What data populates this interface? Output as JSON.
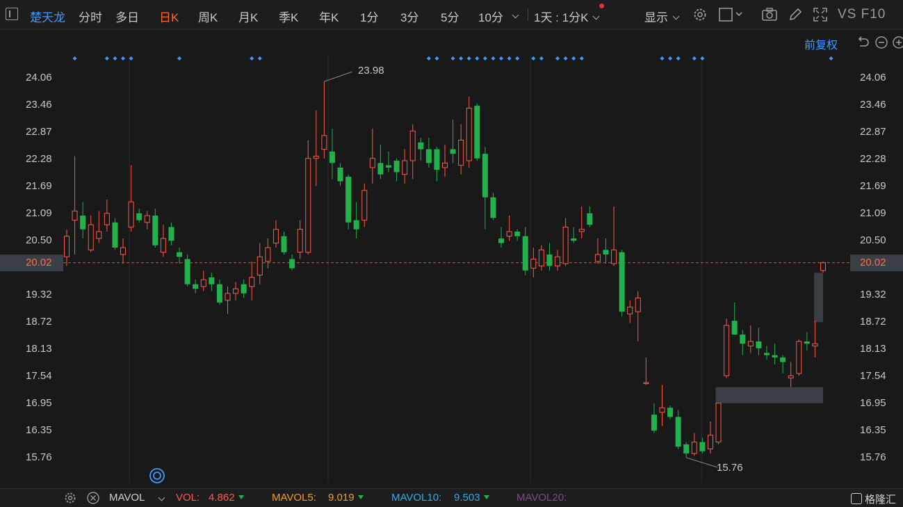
{
  "toolbar": {
    "stock_name": "楚天龙",
    "periods": [
      "分时",
      "多日",
      "日K",
      "周K",
      "月K",
      "季K",
      "年K",
      "1分",
      "3分",
      "5分",
      "10分"
    ],
    "active_period": "日K",
    "multi_period": "1天 : 1分K",
    "display_label": "显示",
    "vs_f10": "VS F10"
  },
  "chart_header": {
    "adjust_label": "前复权"
  },
  "price_axis": {
    "ticks": [
      "24.06",
      "23.46",
      "22.87",
      "22.28",
      "21.69",
      "21.09",
      "20.50",
      "20.02",
      "19.32",
      "18.72",
      "18.13",
      "17.54",
      "16.95",
      "16.35",
      "15.76"
    ],
    "current_price": "20.02"
  },
  "annotations": {
    "high_label": "23.98",
    "low_label": "15.76"
  },
  "indicator_bar": {
    "name": "MAVOL",
    "vol_label": "VOL:",
    "vol_value": "4.862",
    "mavol5_label": "MAVOL5:",
    "mavol5_value": "9.019",
    "mavol10_label": "MAVOL10:",
    "mavol10_value": "9.503",
    "mavol20_label": "MAVOL20:",
    "brand": "格隆汇"
  },
  "colors": {
    "up": "#ff5a4a",
    "down": "#23b14d",
    "accent_blue": "#3e9bff",
    "active_orange": "#ff6a2b",
    "background": "#191919"
  },
  "chart_data": {
    "type": "candlestick",
    "y_range": [
      15.5,
      24.5
    ],
    "current_price": 20.02,
    "marked_high": 23.98,
    "marked_low": 15.76,
    "candles": [
      {
        "o": 20.15,
        "c": 20.6,
        "h": 20.75,
        "l": 19.95
      },
      {
        "o": 20.95,
        "c": 21.15,
        "h": 22.35,
        "l": 20.2
      },
      {
        "o": 21.05,
        "c": 20.75,
        "h": 21.35,
        "l": 20.55
      },
      {
        "o": 20.3,
        "c": 20.85,
        "h": 21.05,
        "l": 20.25
      },
      {
        "o": 20.55,
        "c": 20.7,
        "h": 21.15,
        "l": 20.45
      },
      {
        "o": 20.85,
        "c": 21.1,
        "h": 21.4,
        "l": 20.7
      },
      {
        "o": 20.9,
        "c": 20.35,
        "h": 21.0,
        "l": 20.3
      },
      {
        "o": 20.2,
        "c": 20.35,
        "h": 20.55,
        "l": 20.0
      },
      {
        "o": 20.8,
        "c": 21.35,
        "h": 22.15,
        "l": 20.7
      },
      {
        "o": 21.1,
        "c": 20.95,
        "h": 21.2,
        "l": 20.9
      },
      {
        "o": 20.9,
        "c": 21.05,
        "h": 21.15,
        "l": 20.75
      },
      {
        "o": 21.05,
        "c": 20.4,
        "h": 21.2,
        "l": 20.35
      },
      {
        "o": 20.25,
        "c": 20.55,
        "h": 20.85,
        "l": 20.15
      },
      {
        "o": 20.8,
        "c": 20.5,
        "h": 20.9,
        "l": 20.4
      },
      {
        "o": 20.25,
        "c": 20.15,
        "h": 20.35,
        "l": 20.0
      },
      {
        "o": 20.1,
        "c": 19.55,
        "h": 20.2,
        "l": 19.5
      },
      {
        "o": 19.55,
        "c": 19.45,
        "h": 19.65,
        "l": 19.35
      },
      {
        "o": 19.5,
        "c": 19.65,
        "h": 19.85,
        "l": 19.4
      },
      {
        "o": 19.7,
        "c": 19.55,
        "h": 19.8,
        "l": 19.4
      },
      {
        "o": 19.55,
        "c": 19.15,
        "h": 19.65,
        "l": 19.1
      },
      {
        "o": 19.2,
        "c": 19.35,
        "h": 19.5,
        "l": 18.9
      },
      {
        "o": 19.35,
        "c": 19.45,
        "h": 19.6,
        "l": 19.2
      },
      {
        "o": 19.55,
        "c": 19.35,
        "h": 19.65,
        "l": 19.25
      },
      {
        "o": 19.5,
        "c": 19.7,
        "h": 20.05,
        "l": 19.2
      },
      {
        "o": 19.75,
        "c": 20.15,
        "h": 20.45,
        "l": 19.55
      },
      {
        "o": 20.05,
        "c": 20.35,
        "h": 20.55,
        "l": 19.9
      },
      {
        "o": 20.45,
        "c": 20.75,
        "h": 20.95,
        "l": 20.35
      },
      {
        "o": 20.6,
        "c": 20.25,
        "h": 20.7,
        "l": 20.2
      },
      {
        "o": 20.1,
        "c": 19.9,
        "h": 20.2,
        "l": 19.85
      },
      {
        "o": 20.25,
        "c": 20.75,
        "h": 20.95,
        "l": 20.1
      },
      {
        "o": 20.25,
        "c": 22.3,
        "h": 22.7,
        "l": 20.2
      },
      {
        "o": 22.3,
        "c": 22.35,
        "h": 23.35,
        "l": 21.7
      },
      {
        "o": 22.5,
        "c": 22.8,
        "h": 23.98,
        "l": 22.3
      },
      {
        "o": 22.45,
        "c": 22.2,
        "h": 22.95,
        "l": 21.85
      },
      {
        "o": 22.1,
        "c": 21.8,
        "h": 22.2,
        "l": 21.7
      },
      {
        "o": 21.9,
        "c": 20.9,
        "h": 21.95,
        "l": 20.75
      },
      {
        "o": 20.95,
        "c": 20.75,
        "h": 21.35,
        "l": 20.55
      },
      {
        "o": 20.95,
        "c": 21.6,
        "h": 21.75,
        "l": 20.8
      },
      {
        "o": 22.1,
        "c": 22.3,
        "h": 22.95,
        "l": 21.75
      },
      {
        "o": 22.2,
        "c": 21.95,
        "h": 22.6,
        "l": 21.85
      },
      {
        "o": 22.15,
        "c": 22.1,
        "h": 22.45,
        "l": 22.0
      },
      {
        "o": 22.25,
        "c": 22.0,
        "h": 22.3,
        "l": 21.8
      },
      {
        "o": 21.95,
        "c": 22.25,
        "h": 22.5,
        "l": 21.75
      },
      {
        "o": 22.25,
        "c": 22.9,
        "h": 23.05,
        "l": 21.85
      },
      {
        "o": 22.65,
        "c": 22.5,
        "h": 22.75,
        "l": 22.25
      },
      {
        "o": 22.5,
        "c": 22.2,
        "h": 22.75,
        "l": 22.1
      },
      {
        "o": 22.5,
        "c": 22.05,
        "h": 22.55,
        "l": 21.8
      },
      {
        "o": 22.1,
        "c": 22.2,
        "h": 22.6,
        "l": 21.9
      },
      {
        "o": 22.5,
        "c": 22.4,
        "h": 23.15,
        "l": 22.2
      },
      {
        "o": 22.15,
        "c": 22.7,
        "h": 23.05,
        "l": 21.95
      },
      {
        "o": 22.25,
        "c": 23.4,
        "h": 23.65,
        "l": 22.1
      },
      {
        "o": 23.45,
        "c": 22.3,
        "h": 23.5,
        "l": 22.25
      },
      {
        "o": 22.4,
        "c": 21.45,
        "h": 22.55,
        "l": 20.75
      },
      {
        "o": 21.45,
        "c": 21.0,
        "h": 21.55,
        "l": 20.95
      },
      {
        "o": 20.55,
        "c": 20.45,
        "h": 20.8,
        "l": 20.35
      },
      {
        "o": 20.6,
        "c": 20.7,
        "h": 21.05,
        "l": 20.5
      },
      {
        "o": 20.7,
        "c": 20.6,
        "h": 20.75,
        "l": 20.5
      },
      {
        "o": 20.6,
        "c": 19.85,
        "h": 20.8,
        "l": 19.75
      },
      {
        "o": 19.9,
        "c": 20.1,
        "h": 20.35,
        "l": 19.7
      },
      {
        "o": 19.95,
        "c": 20.3,
        "h": 20.4,
        "l": 19.85
      },
      {
        "o": 20.2,
        "c": 19.95,
        "h": 20.45,
        "l": 19.85
      },
      {
        "o": 19.95,
        "c": 20.15,
        "h": 20.3,
        "l": 19.85
      },
      {
        "o": 20.0,
        "c": 20.8,
        "h": 21.0,
        "l": 19.95
      },
      {
        "o": 20.55,
        "c": 20.5,
        "h": 20.8,
        "l": 20.45
      },
      {
        "o": 20.7,
        "c": 20.75,
        "h": 21.25,
        "l": 20.55
      },
      {
        "o": 21.1,
        "c": 20.85,
        "h": 21.25,
        "l": 20.8
      },
      {
        "o": 20.05,
        "c": 20.2,
        "h": 20.55,
        "l": 20.0
      },
      {
        "o": 20.3,
        "c": 20.2,
        "h": 20.55,
        "l": 20.0
      },
      {
        "o": 20.0,
        "c": 20.3,
        "h": 21.25,
        "l": 19.95
      },
      {
        "o": 20.25,
        "c": 18.95,
        "h": 20.3,
        "l": 18.85
      },
      {
        "o": 18.9,
        "c": 19.05,
        "h": 19.2,
        "l": 18.7
      },
      {
        "o": 18.95,
        "c": 19.25,
        "h": 19.4,
        "l": 18.3
      },
      {
        "o": 17.4,
        "c": 17.4,
        "h": 17.95,
        "l": 17.35
      },
      {
        "o": 16.7,
        "c": 16.35,
        "h": 16.95,
        "l": 16.3
      },
      {
        "o": 16.75,
        "c": 16.85,
        "h": 17.35,
        "l": 16.45
      },
      {
        "o": 16.85,
        "c": 16.65,
        "h": 16.9,
        "l": 16.6
      },
      {
        "o": 16.65,
        "c": 16.0,
        "h": 16.8,
        "l": 15.95
      },
      {
        "o": 16.05,
        "c": 15.85,
        "h": 16.1,
        "l": 15.76
      },
      {
        "o": 15.85,
        "c": 16.1,
        "h": 16.3,
        "l": 15.8
      },
      {
        "o": 16.1,
        "c": 15.9,
        "h": 16.2,
        "l": 15.85
      },
      {
        "o": 15.95,
        "c": 16.25,
        "h": 16.55,
        "l": 15.85
      },
      {
        "o": 16.1,
        "c": 16.95,
        "h": 16.95,
        "l": 16.05
      },
      {
        "o": 17.55,
        "c": 18.65,
        "h": 18.8,
        "l": 17.5
      },
      {
        "o": 18.75,
        "c": 18.45,
        "h": 19.15,
        "l": 18.45
      },
      {
        "o": 18.45,
        "c": 18.25,
        "h": 18.55,
        "l": 18.0
      },
      {
        "o": 18.2,
        "c": 18.3,
        "h": 18.65,
        "l": 18.05
      },
      {
        "o": 18.3,
        "c": 18.15,
        "h": 18.6,
        "l": 18.0
      },
      {
        "o": 18.05,
        "c": 18.0,
        "h": 18.2,
        "l": 17.9
      },
      {
        "o": 18.0,
        "c": 17.95,
        "h": 18.25,
        "l": 17.8
      },
      {
        "o": 17.95,
        "c": 17.85,
        "h": 18.0,
        "l": 17.6
      },
      {
        "o": 17.5,
        "c": 17.55,
        "h": 17.85,
        "l": 17.3
      },
      {
        "o": 17.6,
        "c": 18.3,
        "h": 18.35,
        "l": 17.55
      },
      {
        "o": 18.3,
        "c": 18.25,
        "h": 18.5,
        "l": 18.1
      },
      {
        "o": 18.2,
        "c": 18.25,
        "h": 18.75,
        "l": 17.95
      },
      {
        "o": 19.85,
        "c": 20.02,
        "h": 20.05,
        "l": 19.8
      }
    ],
    "gaps": [
      {
        "from": 16.95,
        "to": 17.3
      },
      {
        "from": 18.72,
        "to": 19.8
      }
    ],
    "volume_marker_indices": [
      1,
      5,
      6,
      7,
      8,
      14,
      23,
      24,
      45,
      46,
      48,
      49,
      50,
      51,
      52,
      53,
      54,
      55,
      56,
      58,
      59,
      61,
      62,
      63,
      64,
      74,
      75,
      76,
      78,
      79,
      95
    ]
  }
}
